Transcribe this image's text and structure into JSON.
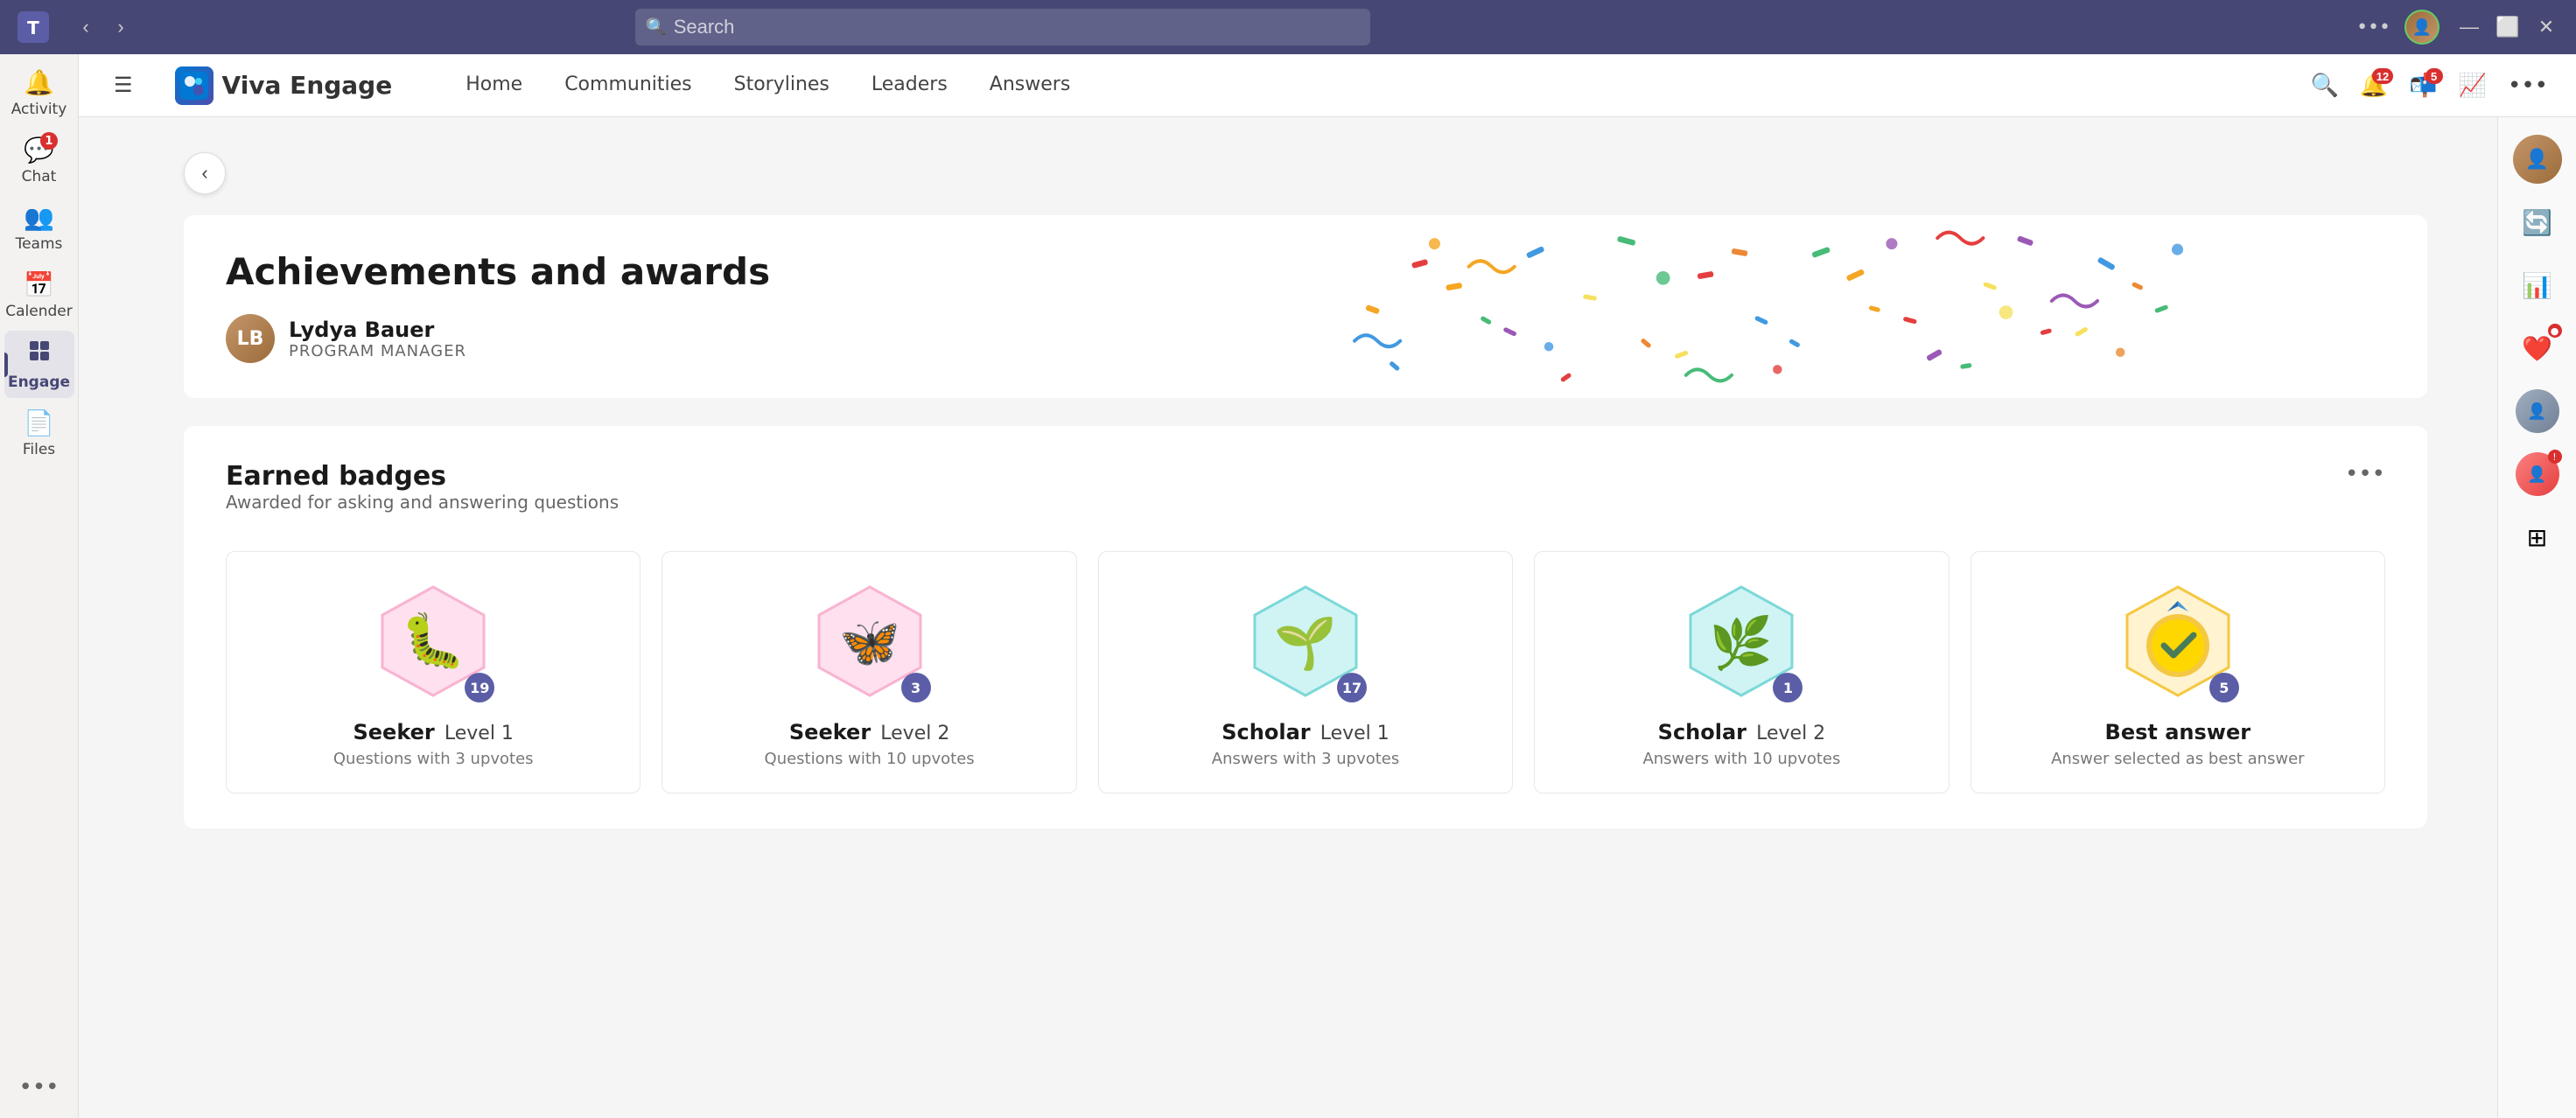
{
  "titlebar": {
    "search_placeholder": "Search",
    "nav_back": "‹",
    "nav_forward": "›",
    "dots_label": "•••",
    "win_minimize": "—",
    "win_maximize": "⬜",
    "win_close": "✕"
  },
  "teams_sidebar": {
    "items": [
      {
        "id": "activity",
        "label": "Activity",
        "icon": "🔔",
        "badge": null
      },
      {
        "id": "chat",
        "label": "Chat",
        "icon": "💬",
        "badge": "1"
      },
      {
        "id": "teams",
        "label": "Teams",
        "icon": "👥",
        "badge": null
      },
      {
        "id": "calendar",
        "label": "Calender",
        "icon": "📅",
        "badge": null
      },
      {
        "id": "engage",
        "label": "Engage",
        "icon": "◈",
        "badge": null,
        "active": true
      },
      {
        "id": "files",
        "label": "Files",
        "icon": "📄",
        "badge": null
      }
    ],
    "more_label": "•••"
  },
  "app_header": {
    "logo_text": "Viva Engage",
    "nav_items": [
      {
        "id": "home",
        "label": "Home"
      },
      {
        "id": "communities",
        "label": "Communities"
      },
      {
        "id": "storylines",
        "label": "Storylines"
      },
      {
        "id": "leaders",
        "label": "Leaders"
      },
      {
        "id": "answers",
        "label": "Answers"
      }
    ],
    "search_icon": "🔍",
    "notifications_badge": "12",
    "inbox_badge": "5",
    "analytics_icon": "📈",
    "more_dots": "•••"
  },
  "page": {
    "back_button": "‹",
    "title": "Achievements and awards",
    "user_name": "Lydya Bauer",
    "user_title": "PROGRAM MANAGER"
  },
  "badges_section": {
    "title": "Earned badges",
    "subtitle": "Awarded for asking and answering questions",
    "more_dots": "•••",
    "badges": [
      {
        "id": "seeker-l1",
        "name": "Seeker",
        "level": "Level 1",
        "description": "Questions with 3 upvotes",
        "count": "19",
        "type": "seeker",
        "color": "pink"
      },
      {
        "id": "seeker-l2",
        "name": "Seeker",
        "level": "Level 2",
        "description": "Questions with 10 upvotes",
        "count": "3",
        "type": "seeker",
        "color": "pink"
      },
      {
        "id": "scholar-l1",
        "name": "Scholar",
        "level": "Level 1",
        "description": "Answers with 3 upvotes",
        "count": "17",
        "type": "scholar",
        "color": "teal"
      },
      {
        "id": "scholar-l2",
        "name": "Scholar",
        "level": "Level 2",
        "description": "Answers with 10 upvotes",
        "count": "1",
        "type": "scholar",
        "color": "teal"
      },
      {
        "id": "best-answer",
        "name": "Best answer",
        "level": "",
        "description": "Answer selected as best answer",
        "count": "5",
        "type": "best",
        "color": "gold"
      }
    ]
  },
  "right_sidebar": {
    "items": [
      {
        "id": "avatar",
        "icon": "👤"
      },
      {
        "id": "refresh",
        "icon": "🔄"
      },
      {
        "id": "chart",
        "icon": "📊"
      },
      {
        "id": "heart-badge",
        "icon": "❤️"
      },
      {
        "id": "person2",
        "icon": "👤"
      },
      {
        "id": "person3",
        "icon": "👤"
      },
      {
        "id": "grid",
        "icon": "⊞"
      }
    ]
  }
}
